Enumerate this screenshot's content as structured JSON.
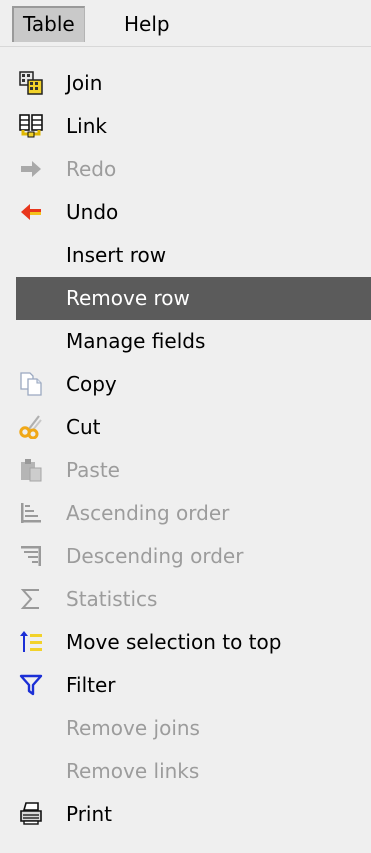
{
  "menubar": {
    "items": [
      {
        "label": "Table",
        "active": true
      },
      {
        "label": "Help",
        "active": false
      }
    ]
  },
  "menu": {
    "items": [
      {
        "label": "Join",
        "icon": "join-icon",
        "enabled": true
      },
      {
        "label": "Link",
        "icon": "link-icon",
        "enabled": true
      },
      {
        "label": "Redo",
        "icon": "redo-arrow-icon",
        "enabled": false
      },
      {
        "label": "Undo",
        "icon": "undo-arrow-icon",
        "enabled": true
      },
      {
        "label": "Insert row",
        "icon": "",
        "enabled": true
      },
      {
        "label": "Remove row",
        "icon": "",
        "enabled": true,
        "selected": true
      },
      {
        "label": "Manage fields",
        "icon": "",
        "enabled": true
      },
      {
        "label": "Copy",
        "icon": "copy-icon",
        "enabled": true
      },
      {
        "label": "Cut",
        "icon": "scissors-icon",
        "enabled": true
      },
      {
        "label": "Paste",
        "icon": "paste-icon",
        "enabled": false
      },
      {
        "label": "Ascending order",
        "icon": "sort-ascending-icon",
        "enabled": false
      },
      {
        "label": "Descending order",
        "icon": "sort-descending-icon",
        "enabled": false
      },
      {
        "label": "Statistics",
        "icon": "sigma-icon",
        "enabled": false
      },
      {
        "label": "Move selection to top",
        "icon": "move-to-top-icon",
        "enabled": true
      },
      {
        "label": "Filter",
        "icon": "filter-funnel-icon",
        "enabled": true
      },
      {
        "label": "Remove joins",
        "icon": "",
        "enabled": false
      },
      {
        "label": "Remove links",
        "icon": "",
        "enabled": false
      },
      {
        "label": "Print",
        "icon": "printer-icon",
        "enabled": true
      }
    ]
  },
  "colors": {
    "menu_background": "#efefef",
    "selected_background": "#5b5b5b",
    "disabled_text": "#9c9c9c",
    "undo_arrow": "#e8361c",
    "filter_blue": "#1b2fd6"
  }
}
